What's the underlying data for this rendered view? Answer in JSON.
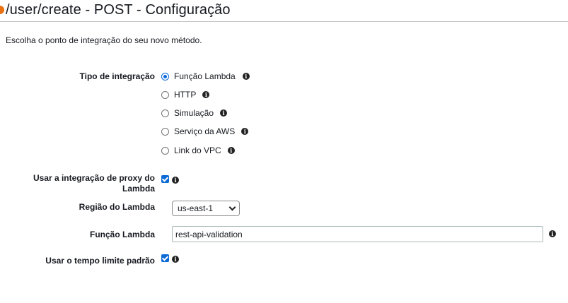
{
  "header": {
    "title": "/user/create - POST - Configuração"
  },
  "intro": "Escolha o ponto de integração do seu novo método.",
  "integration_type": {
    "label": "Tipo de integração",
    "options": [
      {
        "label": "Função Lambda",
        "selected": true
      },
      {
        "label": "HTTP",
        "selected": false
      },
      {
        "label": "Simulação",
        "selected": false
      },
      {
        "label": "Serviço da AWS",
        "selected": false
      },
      {
        "label": "Link do VPC",
        "selected": false
      }
    ]
  },
  "proxy": {
    "label_line1": "Usar a integração de proxy do",
    "label_line2": "Lambda",
    "checked": true
  },
  "region": {
    "label": "Região do Lambda",
    "value": "us-east-1"
  },
  "lambda_function": {
    "label": "Função Lambda",
    "value": "rest-api-validation"
  },
  "timeout": {
    "label": "Usar o tempo limite padrão",
    "checked": true
  },
  "colors": {
    "accent": "#0a6ad6",
    "brand": "#ec7211"
  },
  "icons": {
    "info": "info-icon",
    "chevron": "chevron-down-icon"
  }
}
